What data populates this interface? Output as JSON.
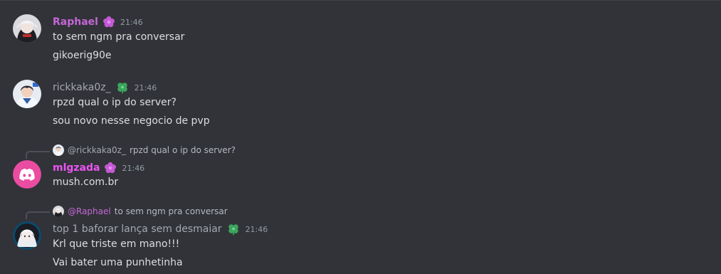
{
  "colors": {
    "background": "#313338",
    "text": "#dbdee1",
    "timestamp": "#949ba4",
    "raphael": "#c467d6",
    "rick": "#a4a8af",
    "mlgzada": "#ea55f0",
    "top1": "#a4a8af",
    "badge_pink": "#c459d6",
    "badge_green": "#3ba55d",
    "discord_avatar_bg": "#e94ca1"
  },
  "messages": [
    {
      "username": "Raphael",
      "badge_icon": "flower-badge-icon",
      "time": "21:46",
      "lines": [
        "to sem ngm pra conversar",
        "gikoerig90e"
      ]
    },
    {
      "username": "rickkaka0z_",
      "badge_icon": "clover-badge-icon",
      "time": "21:46",
      "lines": [
        "rpzd qual o ip do server?",
        "sou novo nesse negocio de pvp"
      ]
    },
    {
      "reply": {
        "mention": "@rickkaka0z_",
        "text": "rpzd qual o ip do server?"
      },
      "username": "mlgzada",
      "badge_icon": "flower-badge-icon",
      "time": "21:46",
      "lines": [
        "mush.com.br"
      ]
    },
    {
      "reply": {
        "mention": "@Raphael",
        "text": "to sem ngm pra conversar"
      },
      "username": "top 1 baforar lança sem desmaiar",
      "badge_icon": "clover-badge-icon",
      "time": "21:46",
      "lines": [
        "Krl que triste em mano!!!",
        "Vai bater uma punhetinha"
      ]
    }
  ]
}
